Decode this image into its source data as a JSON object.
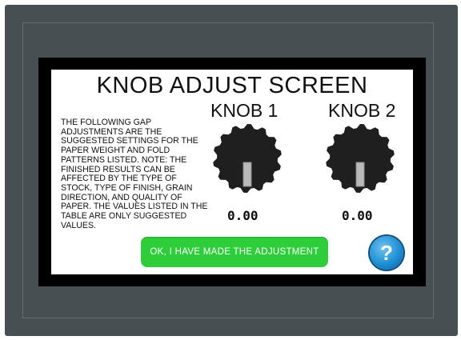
{
  "screen": {
    "title": "KNOB ADJUST SCREEN",
    "instructions": "THE FOLLOWING GAP ADJUSTMENTS ARE THE SUGGESTED SETTINGS FOR THE PAPER WEIGHT AND FOLD PATTERNS LISTED.  NOTE: THE FINISHED RESULTS CAN BE AFFECTED BY THE TYPE OF STOCK, TYPE OF FINISH, GRAIN DIRECTION, AND QUALITY OF PAPER.  THE VALUES LISTED IN THE TABLE ARE ONLY SUGGESTED VALUES."
  },
  "knobs": [
    {
      "label": "KNOB 1",
      "value": "0.00",
      "icon": "knob-dial-icon"
    },
    {
      "label": "KNOB 2",
      "value": "0.00",
      "icon": "knob-dial-icon"
    }
  ],
  "buttons": {
    "ok_label": "OK,  I HAVE MADE THE ADJUSTMENT",
    "help_label": "?",
    "help_icon": "help-question-icon"
  },
  "colors": {
    "bezel": "#474f52",
    "screen_background": "#ffffff",
    "ok_button": "#2ecd3a",
    "help_button": "#1e8fd3",
    "knob": "#1f1f1f"
  }
}
